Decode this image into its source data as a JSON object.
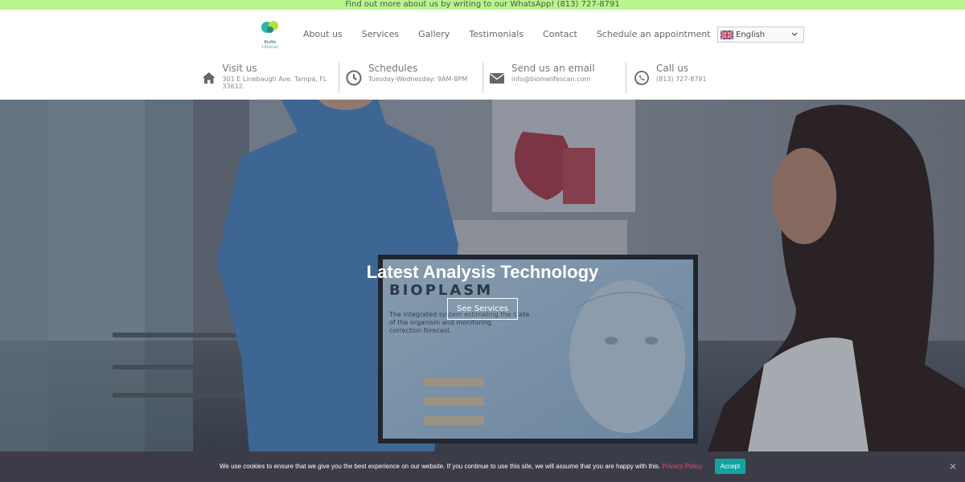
{
  "topbar": {
    "text": "Find out more about us by writing to our WhatsApp! (813) 727-8791"
  },
  "brand": {
    "logo_text": "BioMe Lifescan"
  },
  "nav": {
    "items": [
      "About us",
      "Services",
      "Gallery",
      "Testimonials",
      "Contact",
      "Schedule an appointment"
    ]
  },
  "language": {
    "selected": "English"
  },
  "info": [
    {
      "title": "Visit us",
      "sub": "301 E Linebaugh Ave. Tampa, FL 33612.",
      "icon": "home-icon"
    },
    {
      "title": "Schedules",
      "sub": "Tuesday-Wednesday: 9AM-8PM",
      "icon": "clock-icon"
    },
    {
      "title": "Send us an email",
      "sub": "info@biomelifescan.com",
      "icon": "envelope-icon"
    },
    {
      "title": "Call us",
      "sub": "(813) 727-8791",
      "icon": "whatsapp-icon"
    }
  ],
  "hero": {
    "title": "Latest Analysis Technology",
    "button": "See Services",
    "screen_brand": "BIOPLASM",
    "screen_text": "The integrated system estimating the state of the organism and monitoring correction forecast."
  },
  "cookie": {
    "text": "We use cookies to ensure that we give you the best experience on our website. If you continue to use this site, we will assume that you are happy with this.",
    "link": "Privacy Policy",
    "accept": "Accept",
    "close": "✕"
  },
  "colors": {
    "topbar": "#b9f58e",
    "accent": "#14a3a0",
    "cookie_bg": "#3c3c48",
    "link": "#ff3d6b"
  }
}
